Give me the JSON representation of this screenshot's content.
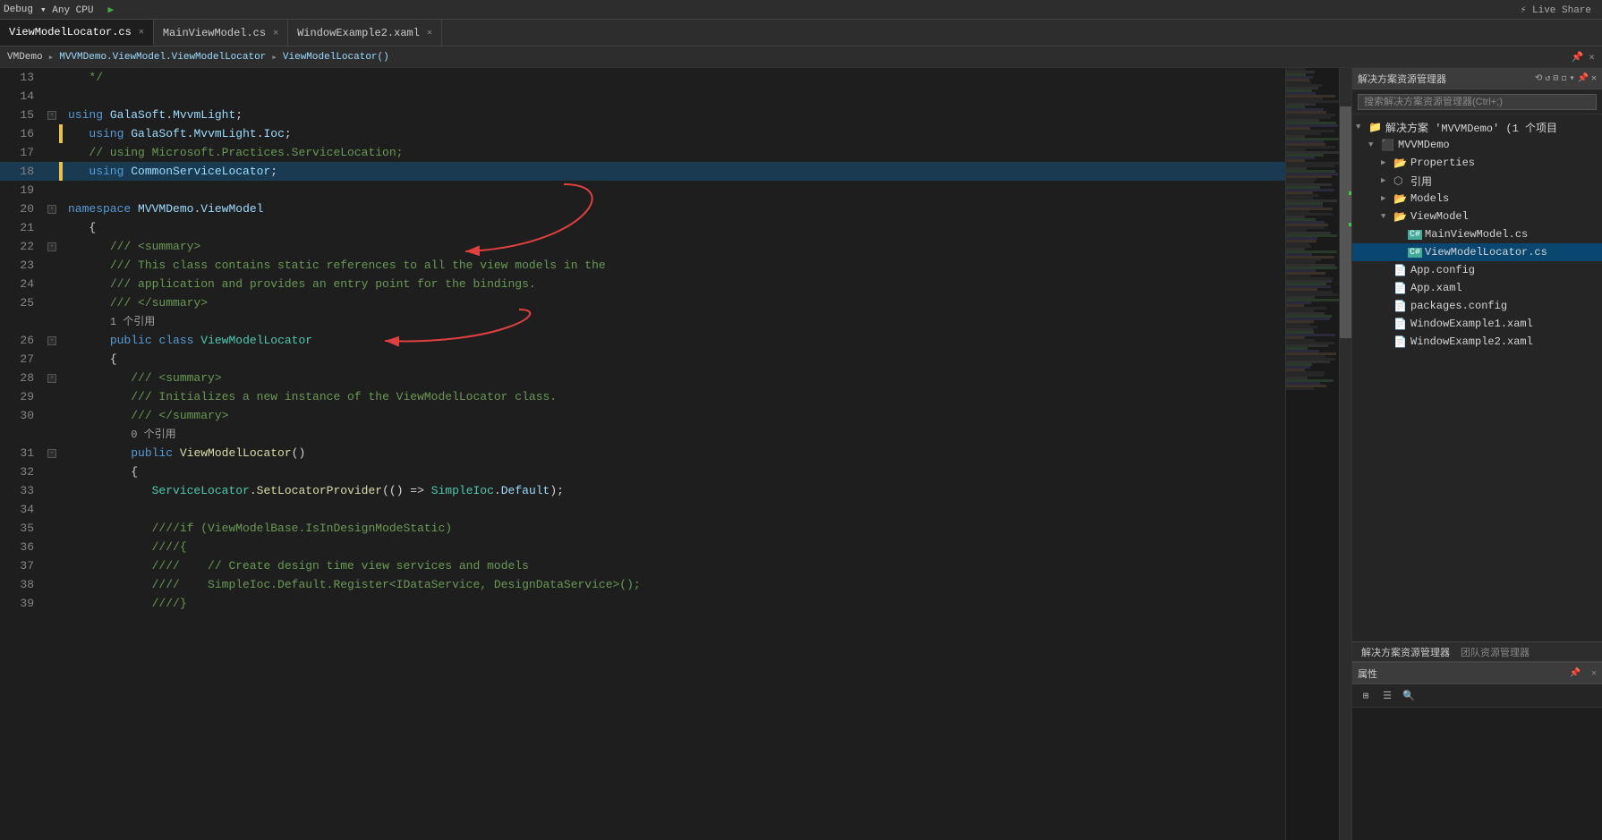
{
  "topbar": {
    "mode": "Debug",
    "cpu": "Any CPU",
    "liveshare": "Live Share"
  },
  "tabs": [
    {
      "id": "viewmodellocator",
      "label": "ViewModelLocator.cs",
      "active": true,
      "modified": false,
      "closeable": true
    },
    {
      "id": "mainviewmodel",
      "label": "MainViewModel.cs",
      "active": false,
      "modified": false,
      "closeable": true
    },
    {
      "id": "windowexample2",
      "label": "WindowExample2.xaml",
      "active": false,
      "modified": false,
      "closeable": true
    }
  ],
  "breadcrumb": {
    "project": "VMDemo",
    "path": "MVVMDemo.ViewModel.ViewModelLocator",
    "member": "ViewModelLocator()"
  },
  "lines": [
    {
      "num": 13,
      "indent": 0,
      "content": "   */",
      "type": "comment"
    },
    {
      "num": 14,
      "indent": 0,
      "content": "",
      "type": "blank"
    },
    {
      "num": 15,
      "indent": 0,
      "content": "using GalaSoft.MvvmLight;",
      "type": "using",
      "foldable": true
    },
    {
      "num": 16,
      "indent": 0,
      "content": "   using GalaSoft.MvvmLight.Ioc;",
      "type": "using",
      "indicator": "yellow"
    },
    {
      "num": 17,
      "indent": 0,
      "content": "   // using Microsoft.Practices.ServiceLocation;",
      "type": "commented-using"
    },
    {
      "num": 18,
      "indent": 0,
      "content": "   using CommonServiceLocator;",
      "type": "using",
      "indicator": "yellow",
      "current": true
    },
    {
      "num": 19,
      "indent": 0,
      "content": "",
      "type": "blank"
    },
    {
      "num": 20,
      "indent": 0,
      "content": "namespace MVVMDemo.ViewModel",
      "type": "namespace",
      "foldable": true
    },
    {
      "num": 21,
      "indent": 0,
      "content": "   {",
      "type": "brace"
    },
    {
      "num": 22,
      "indent": 1,
      "content": "",
      "type": "summary-start",
      "foldable": true
    },
    {
      "num": 23,
      "indent": 1,
      "content": "",
      "type": "summary-text1"
    },
    {
      "num": 24,
      "indent": 1,
      "content": "",
      "type": "summary-text2"
    },
    {
      "num": 25,
      "indent": 1,
      "content": "",
      "type": "summary-end"
    },
    {
      "num": "ref1",
      "indent": 1,
      "content": "1 个引用",
      "type": "ref-hint"
    },
    {
      "num": 26,
      "indent": 1,
      "content": "",
      "type": "class-decl",
      "foldable": true
    },
    {
      "num": 27,
      "indent": 1,
      "content": "      {",
      "type": "brace"
    },
    {
      "num": 28,
      "indent": 2,
      "content": "",
      "type": "summary-start2",
      "foldable": true
    },
    {
      "num": 29,
      "indent": 2,
      "content": "",
      "type": "summary-init-text"
    },
    {
      "num": 30,
      "indent": 2,
      "content": "",
      "type": "summary-end2"
    },
    {
      "num": "ref2",
      "indent": 2,
      "content": "0 个引用",
      "type": "ref-hint"
    },
    {
      "num": 31,
      "indent": 2,
      "content": "",
      "type": "ctor-decl",
      "foldable": true
    },
    {
      "num": 32,
      "indent": 2,
      "content": "         {",
      "type": "brace"
    },
    {
      "num": 33,
      "indent": 3,
      "content": "",
      "type": "servicelocator-call"
    },
    {
      "num": 34,
      "indent": 3,
      "content": "",
      "type": "blank"
    },
    {
      "num": 35,
      "indent": 3,
      "content": "",
      "type": "commented-if"
    },
    {
      "num": 36,
      "indent": 3,
      "content": "",
      "type": "commented-brace-open"
    },
    {
      "num": 37,
      "indent": 3,
      "content": "",
      "type": "commented-create"
    },
    {
      "num": 38,
      "indent": 3,
      "content": "",
      "type": "commented-register"
    },
    {
      "num": 39,
      "indent": 3,
      "content": "",
      "type": "commented-brace-close"
    }
  ],
  "code_lines": [
    {
      "num": 13,
      "html": "   */"
    },
    {
      "num": 14,
      "html": ""
    },
    {
      "num": 15,
      "html": "<span class='kw'>using</span> <span class='ns'>GalaSoft</span><span class='punct'>.</span><span class='ns'>MvvmLight</span><span class='punct'>;</span>",
      "foldable": true
    },
    {
      "num": 16,
      "html": "   <span class='kw'>using</span> <span class='ns'>GalaSoft</span><span class='punct'>.</span><span class='ns'>MvvmLight</span><span class='punct'>.</span><span class='ns'>Ioc</span><span class='punct'>;</span>",
      "indicator": "yellow"
    },
    {
      "num": 17,
      "html": "   <span class='comment'>// using Microsoft.Practices.ServiceLocation;</span>"
    },
    {
      "num": 18,
      "html": "   <span class='kw'>using</span> <span class='ns'>CommonServiceLocator</span><span class='punct'>;</span>",
      "indicator": "yellow",
      "current": true
    },
    {
      "num": 19,
      "html": ""
    },
    {
      "num": 20,
      "html": "<span class='kw'>namespace</span> <span class='ns'>MVVMDemo</span><span class='punct'>.</span><span class='ns'>ViewModel</span>",
      "foldable": true
    },
    {
      "num": 21,
      "html": "   <span class='punct'>{</span>"
    },
    {
      "num": 22,
      "html": "      <span class='comment'>/// &lt;summary&gt;</span>",
      "foldable": true
    },
    {
      "num": 23,
      "html": "      <span class='comment'>/// This class contains static references to all the view models in the</span>"
    },
    {
      "num": 24,
      "html": "      <span class='comment'>/// application and provides an entry point for the bindings.</span>"
    },
    {
      "num": 25,
      "html": "      <span class='comment'>/// &lt;/summary&gt;</span>"
    },
    {
      "num": "r1",
      "html": "      <span class='ref-hint'>1 个引用</span>",
      "is_ref": true
    },
    {
      "num": 26,
      "html": "      <span class='kw'>public</span> <span class='kw'>class</span> <span class='type'>ViewModelLocator</span>",
      "foldable": true
    },
    {
      "num": 27,
      "html": "      <span class='punct'>{</span>"
    },
    {
      "num": 28,
      "html": "         <span class='comment'>/// &lt;summary&gt;</span>",
      "foldable": true
    },
    {
      "num": 29,
      "html": "         <span class='comment'>/// Initializes a new instance of the ViewModelLocator class.</span>"
    },
    {
      "num": 30,
      "html": "         <span class='comment'>/// &lt;/summary&gt;</span>"
    },
    {
      "num": "r2",
      "html": "         <span class='ref-hint'>0 个引用</span>",
      "is_ref": true
    },
    {
      "num": 31,
      "html": "         <span class='kw'>public</span> <span class='method'>ViewModelLocator</span><span class='punct'>()</span>",
      "foldable": true
    },
    {
      "num": 32,
      "html": "         <span class='punct'>{</span>"
    },
    {
      "num": 33,
      "html": "            <span class='type'>ServiceLocator</span><span class='punct'>.</span><span class='method'>SetLocatorProvider</span><span class='punct'>(() =&gt;</span> <span class='type'>SimpleIoc</span><span class='punct'>.</span><span class='ns'>Default</span><span class='punct'>);</span>"
    },
    {
      "num": 34,
      "html": ""
    },
    {
      "num": 35,
      "html": "            <span class='comment'>////if (ViewModelBase.IsInDesignModeStatic)</span>"
    },
    {
      "num": 36,
      "html": "            <span class='comment'>////{</span>"
    },
    {
      "num": 37,
      "html": "            <span class='comment'>////    // Create design time view services and models</span>"
    },
    {
      "num": 38,
      "html": "            <span class='comment'>////    SimpleIoc.Default.Register&lt;IDataService, DesignDataService&gt;();</span>"
    },
    {
      "num": 39,
      "html": "            <span class='comment'>////}</span>"
    }
  ],
  "rightpanel": {
    "title": "解决方案资源管理器",
    "search_placeholder": "搜索解决方案资源管理器(Ctrl+;)",
    "tabs": [
      "解决方案资源管理器",
      "团队资源管理器"
    ],
    "tree": [
      {
        "id": "solution",
        "label": "解决方案 'MVVMDemo' (1 个项目",
        "indent": 0,
        "icon": "solution",
        "expanded": true,
        "arrow": "▼"
      },
      {
        "id": "project",
        "label": "MVVMDemo",
        "indent": 1,
        "icon": "project",
        "expanded": true,
        "arrow": "▼"
      },
      {
        "id": "properties",
        "label": "Properties",
        "indent": 2,
        "icon": "folder",
        "expanded": false,
        "arrow": "▶"
      },
      {
        "id": "references",
        "label": "◈ 引用",
        "indent": 2,
        "icon": "ref",
        "expanded": false,
        "arrow": "▶"
      },
      {
        "id": "models",
        "label": "Models",
        "indent": 2,
        "icon": "folder",
        "expanded": false,
        "arrow": "▶"
      },
      {
        "id": "viewmodel",
        "label": "ViewModel",
        "indent": 2,
        "icon": "folder",
        "expanded": true,
        "arrow": "▼"
      },
      {
        "id": "mainviewmodelcs",
        "label": "C# MainViewModel.cs",
        "indent": 3,
        "icon": "cs",
        "expanded": false,
        "arrow": ""
      },
      {
        "id": "viewmodellocatorms",
        "label": "C# ViewModelLocator.cs",
        "indent": 3,
        "icon": "cs",
        "expanded": false,
        "arrow": "",
        "selected": true
      },
      {
        "id": "appconfig",
        "label": "App.config",
        "indent": 2,
        "icon": "config",
        "expanded": false,
        "arrow": ""
      },
      {
        "id": "appxaml",
        "label": "App.xaml",
        "indent": 2,
        "icon": "xaml",
        "expanded": false,
        "arrow": ""
      },
      {
        "id": "packagesconfig",
        "label": "packages.config",
        "indent": 2,
        "icon": "config",
        "expanded": false,
        "arrow": ""
      },
      {
        "id": "windowexample1xaml",
        "label": "WindowExample1.xaml",
        "indent": 2,
        "icon": "xaml",
        "expanded": false,
        "arrow": ""
      },
      {
        "id": "windowexample2xaml",
        "label": "WindowExample2.xaml",
        "indent": 2,
        "icon": "xaml",
        "expanded": false,
        "arrow": ""
      }
    ]
  },
  "properties": {
    "title": "属性",
    "tabs": [
      "解决方案资源管理器",
      "团队资源管理器"
    ]
  }
}
